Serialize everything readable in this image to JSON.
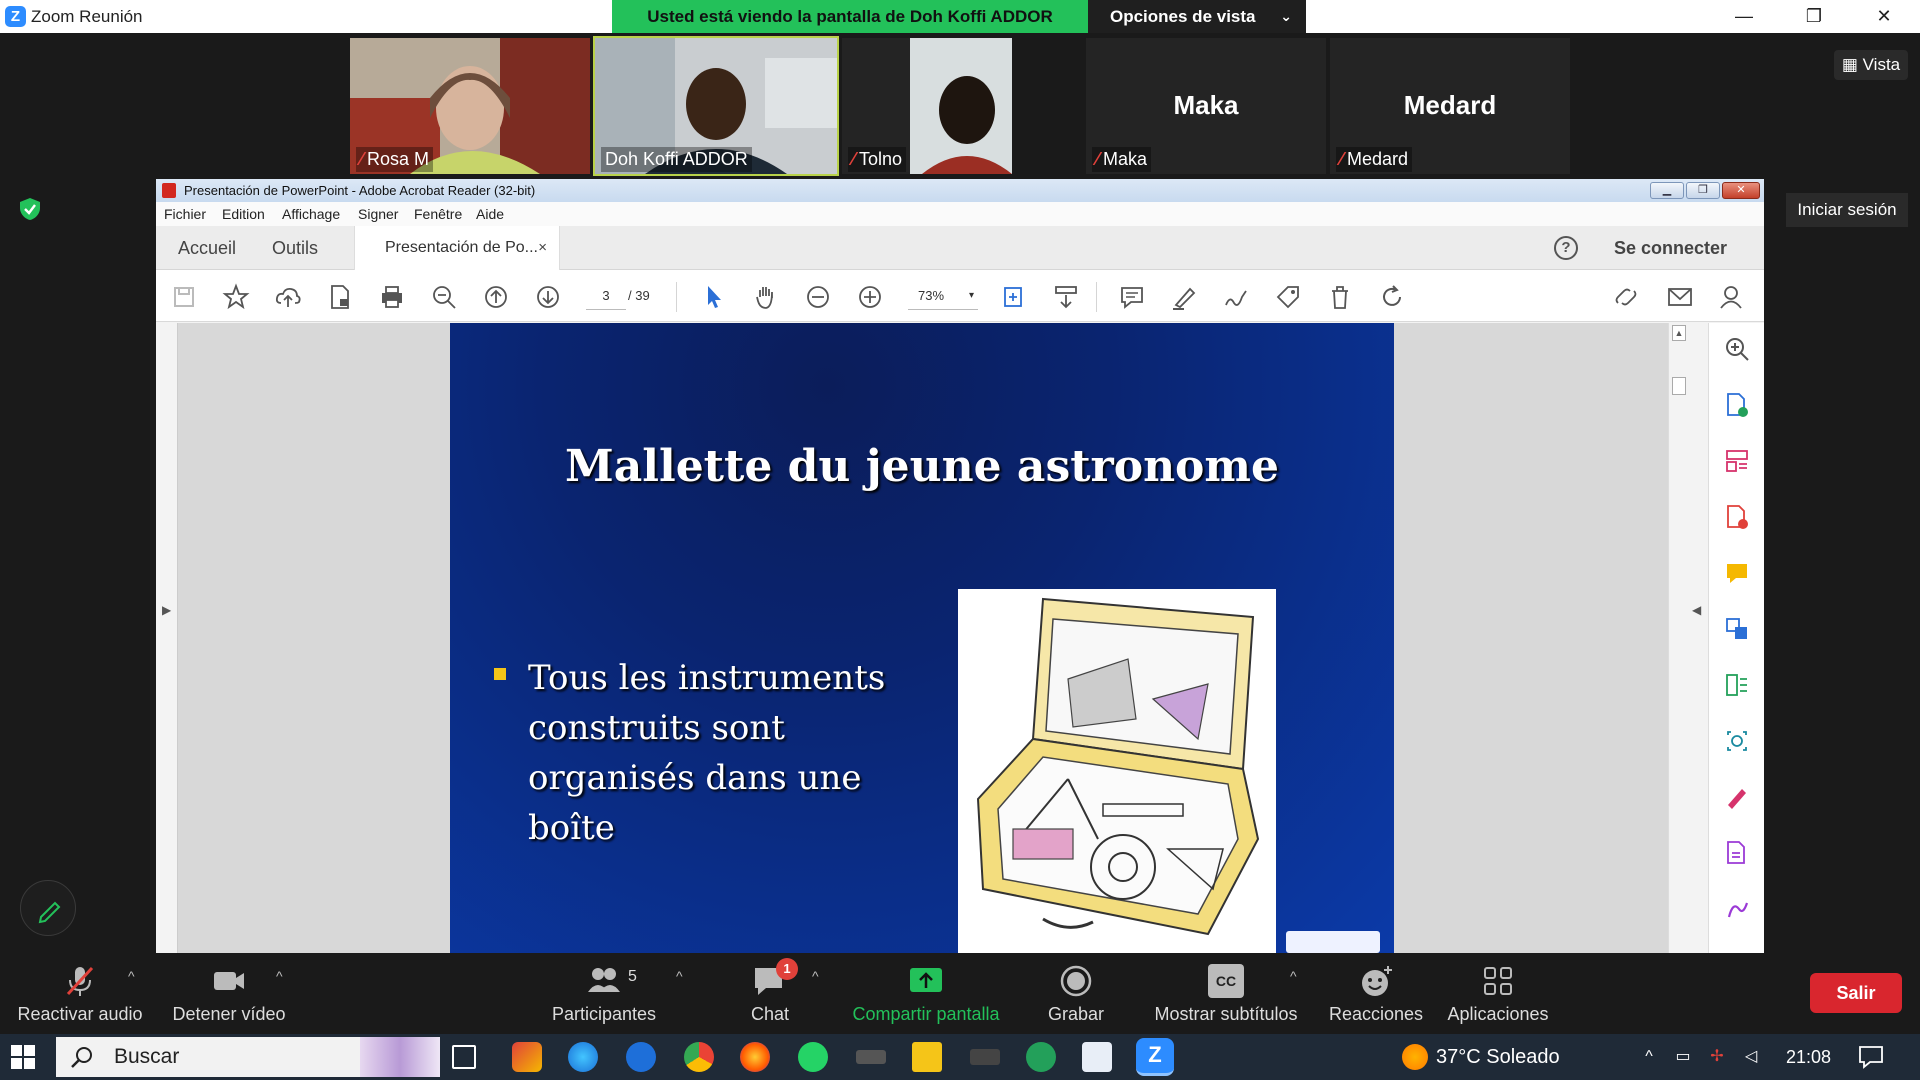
{
  "window": {
    "title": "Zoom Reunión",
    "share_banner": "Usted está viendo la pantalla de Doh Koffi ADDOR",
    "view_options": "Opciones de vista",
    "controls": {
      "minimize": "—",
      "restore": "❐",
      "close": "✕"
    }
  },
  "gallery": [
    {
      "name": "Rosa M",
      "muted": true,
      "has_video": true
    },
    {
      "name": "Doh Koffi ADDOR",
      "muted": false,
      "has_video": true,
      "active": true
    },
    {
      "name": "Tolno",
      "muted": true,
      "has_video": true
    },
    {
      "name": "Maka",
      "big_name": "Maka",
      "muted": true,
      "has_video": false
    },
    {
      "name": "Medard",
      "big_name": "Medard",
      "muted": true,
      "has_video": false
    }
  ],
  "side_buttons": {
    "vista": "Vista",
    "iniciar_sesion": "Iniciar sesión"
  },
  "acrobat": {
    "title": "Presentación de PowerPoint - Adobe Acrobat Reader (32-bit)",
    "menu": [
      "Fichier",
      "Edition",
      "Affichage",
      "Signer",
      "Fenêtre",
      "Aide"
    ],
    "tabs": {
      "home": "Accueil",
      "tools": "Outils",
      "doc": "Presentación de Po...",
      "doc_close": "×"
    },
    "help": "?",
    "connect": "Se connecter",
    "page_current": "3",
    "page_total": "/ 39",
    "zoom": "73%",
    "zoom_dropdown": "▾",
    "window_buttons": {
      "minimize": "▁",
      "restore": "❐",
      "close": "✕"
    }
  },
  "slide": {
    "title": "Mallette du jeune astronome",
    "bullet": "Tous les instruments construits sont organisés dans une boîte"
  },
  "control_bar": {
    "audio": "Reactivar audio",
    "video": "Detener vídeo",
    "participants": "Participantes",
    "participants_count": "5",
    "chat": "Chat",
    "chat_badge": "1",
    "share": "Compartir pantalla",
    "record": "Grabar",
    "captions": "Mostrar subtítulos",
    "captions_icon": "CC",
    "reactions": "Reacciones",
    "apps": "Aplicaciones",
    "leave": "Salir",
    "caret": "^"
  },
  "taskbar": {
    "search_placeholder": "Buscar",
    "weather": "37°C  Soleado",
    "time": "21:08",
    "tray_up": "^"
  },
  "colors": {
    "zoom_blue": "#2d8cff",
    "share_green": "#23c15a",
    "leave_red": "#d9262e",
    "muted_red": "#e0413a",
    "slide_blue": "#0b3aa8"
  }
}
